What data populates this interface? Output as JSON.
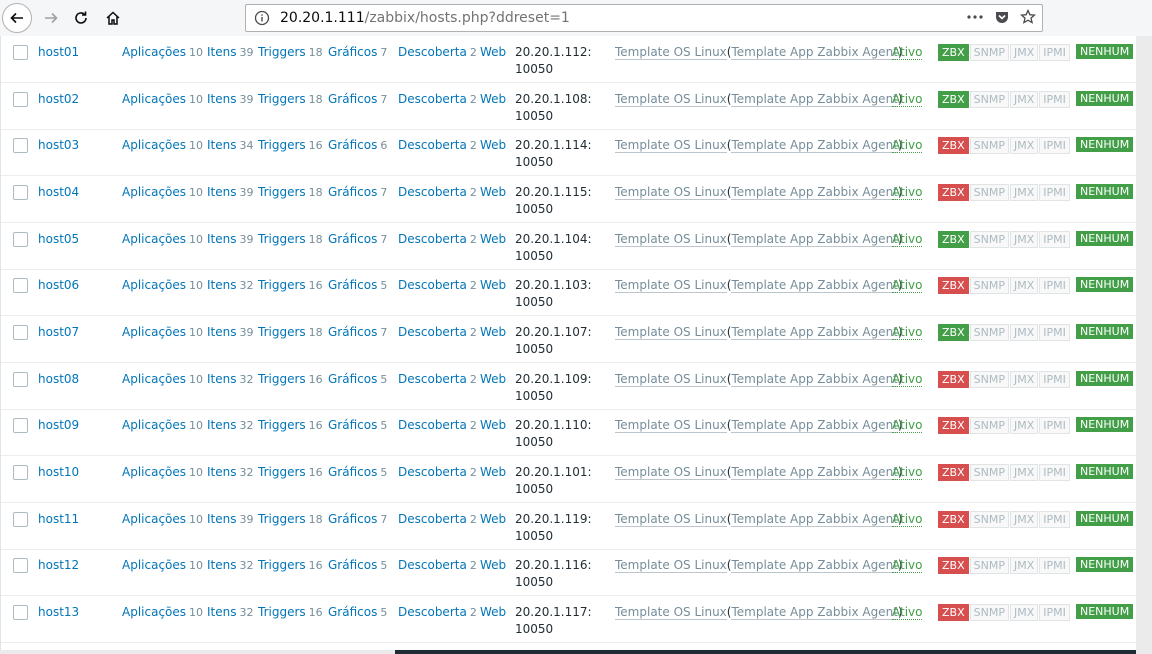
{
  "browser": {
    "url_host": "20.20.1.111",
    "url_path": "/zabbix/hosts.php?ddreset=1"
  },
  "colors": {
    "available": "#429e47",
    "unavailable": "#d64e4e"
  },
  "labels": {
    "applications": "Aplicações",
    "items": "Itens",
    "triggers": "Triggers",
    "graphs": "Gráficos",
    "discovery": "Descoberta",
    "web": "Web",
    "template": "Template OS Linux",
    "template_child": "Template App Zabbix Agent",
    "status": "Ativo",
    "zbx": "ZBX",
    "snmp": "SNMP",
    "jmx": "JMX",
    "ipmi": "IPMI",
    "encryption": "NENHUM",
    "port": "10050"
  },
  "hosts": [
    {
      "name": "host01",
      "apps": "10",
      "items": "39",
      "triggers": "18",
      "graphs": "7",
      "discovery": "2",
      "ip": "20.20.1.112:",
      "zbx_ok": true
    },
    {
      "name": "host02",
      "apps": "10",
      "items": "39",
      "triggers": "18",
      "graphs": "7",
      "discovery": "2",
      "ip": "20.20.1.108:",
      "zbx_ok": true
    },
    {
      "name": "host03",
      "apps": "10",
      "items": "34",
      "triggers": "16",
      "graphs": "6",
      "discovery": "2",
      "ip": "20.20.1.114:",
      "zbx_ok": false
    },
    {
      "name": "host04",
      "apps": "10",
      "items": "39",
      "triggers": "18",
      "graphs": "7",
      "discovery": "2",
      "ip": "20.20.1.115:",
      "zbx_ok": false
    },
    {
      "name": "host05",
      "apps": "10",
      "items": "39",
      "triggers": "18",
      "graphs": "7",
      "discovery": "2",
      "ip": "20.20.1.104:",
      "zbx_ok": true
    },
    {
      "name": "host06",
      "apps": "10",
      "items": "32",
      "triggers": "16",
      "graphs": "5",
      "discovery": "2",
      "ip": "20.20.1.103:",
      "zbx_ok": false
    },
    {
      "name": "host07",
      "apps": "10",
      "items": "39",
      "triggers": "18",
      "graphs": "7",
      "discovery": "2",
      "ip": "20.20.1.107:",
      "zbx_ok": true
    },
    {
      "name": "host08",
      "apps": "10",
      "items": "32",
      "triggers": "16",
      "graphs": "5",
      "discovery": "2",
      "ip": "20.20.1.109:",
      "zbx_ok": false
    },
    {
      "name": "host09",
      "apps": "10",
      "items": "32",
      "triggers": "16",
      "graphs": "5",
      "discovery": "2",
      "ip": "20.20.1.110:",
      "zbx_ok": false
    },
    {
      "name": "host10",
      "apps": "10",
      "items": "32",
      "triggers": "16",
      "graphs": "5",
      "discovery": "2",
      "ip": "20.20.1.101:",
      "zbx_ok": false
    },
    {
      "name": "host11",
      "apps": "10",
      "items": "39",
      "triggers": "18",
      "graphs": "7",
      "discovery": "2",
      "ip": "20.20.1.119:",
      "zbx_ok": false
    },
    {
      "name": "host12",
      "apps": "10",
      "items": "32",
      "triggers": "16",
      "graphs": "5",
      "discovery": "2",
      "ip": "20.20.1.116:",
      "zbx_ok": false
    },
    {
      "name": "host13",
      "apps": "10",
      "items": "32",
      "triggers": "16",
      "graphs": "5",
      "discovery": "2",
      "ip": "20.20.1.117:",
      "zbx_ok": false
    }
  ]
}
